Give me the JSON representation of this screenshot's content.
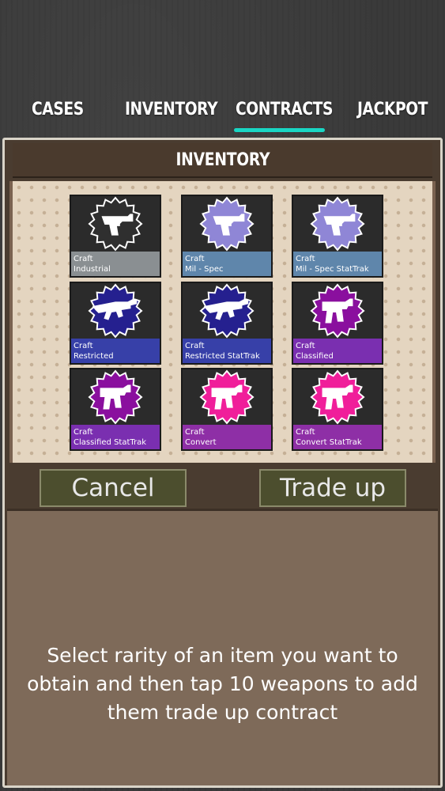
{
  "tabs": [
    {
      "label": "CASES",
      "active": false
    },
    {
      "label": "INVENTORY",
      "active": false
    },
    {
      "label": "CONTRACTS",
      "active": true
    },
    {
      "label": "JACKPOT",
      "active": false
    }
  ],
  "colors": {
    "tab_underline": "#19d6c4",
    "industrial": "#8a8f92",
    "mil_spec": "#5f86ab",
    "restricted": "#3740a8",
    "classified": "#7a2fb0",
    "convert": "#8e2fa6"
  },
  "inventory": {
    "title": "INVENTORY",
    "items": [
      {
        "line1": "Craft",
        "line2": "Industrial",
        "icon": "pistol-icon",
        "badge_color": "#2f2f2f",
        "label_color": "#8a8f92"
      },
      {
        "line1": "Craft",
        "line2": "Mil - Spec",
        "icon": "pistol-icon",
        "badge_color": "#8f86d6",
        "label_color": "#5f86ab"
      },
      {
        "line1": "Craft",
        "line2": "Mil - Spec StatTrak",
        "icon": "pistol-icon",
        "badge_color": "#8f86d6",
        "label_color": "#5f86ab"
      },
      {
        "line1": "Craft",
        "line2": "Restricted",
        "icon": "rifle-icon",
        "badge_color": "#25208f",
        "label_color": "#3740a8"
      },
      {
        "line1": "Craft",
        "line2": "Restricted StatTrak",
        "icon": "rifle-icon",
        "badge_color": "#25208f",
        "label_color": "#3740a8"
      },
      {
        "line1": "Craft",
        "line2": "Classified",
        "icon": "smg-icon",
        "badge_color": "#8a0f9e",
        "label_color": "#7a2fb0"
      },
      {
        "line1": "Craft",
        "line2": "Classified StatTrak",
        "icon": "smg-icon",
        "badge_color": "#8a0f9e",
        "label_color": "#7a2fb0"
      },
      {
        "line1": "Craft",
        "line2": "Convert",
        "icon": "smg-icon",
        "badge_color": "#f01e9a",
        "label_color": "#8e2fa6"
      },
      {
        "line1": "Craft",
        "line2": "Convert StatTrak",
        "icon": "smg-icon",
        "badge_color": "#f01e9a",
        "label_color": "#8e2fa6"
      }
    ]
  },
  "actions": {
    "cancel_label": "Cancel",
    "trade_up_label": "Trade up"
  },
  "instructions": {
    "text": "Select rarity of an item you want to obtain and then tap 10 weapons to add them trade up contract"
  }
}
